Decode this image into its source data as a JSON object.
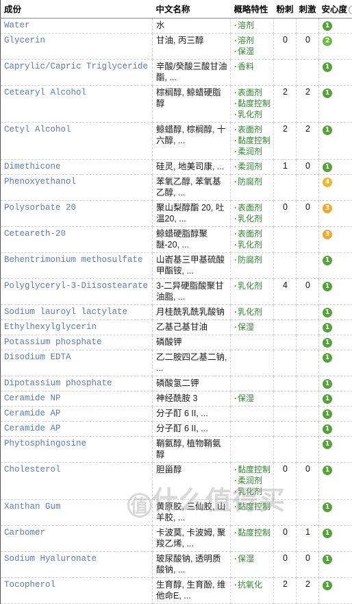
{
  "table": {
    "columns": [
      {
        "key": "name",
        "label": "成份"
      },
      {
        "key": "cn",
        "label": "中文名称"
      },
      {
        "key": "prop",
        "label": "概略特性"
      },
      {
        "key": "acne",
        "label": "粉刺"
      },
      {
        "key": "irr",
        "label": "刺激"
      },
      {
        "key": "safe",
        "label": "安心度"
      }
    ],
    "help_icon": "?",
    "rows": [
      {
        "name": "Water",
        "cn": "水",
        "props": [
          "溶剂"
        ],
        "acne": "",
        "irr": "",
        "safe": "1"
      },
      {
        "name": "Glycerin",
        "cn": "甘油, 丙三醇",
        "props": [
          "溶剂",
          "保湿"
        ],
        "acne": "0",
        "irr": "0",
        "safe": "2"
      },
      {
        "name": "Caprylic/Capric Triglyceride",
        "cn": "辛酸/癸酸三酸甘油酯, ...",
        "props": [
          "香料"
        ],
        "acne": "",
        "irr": "",
        "safe": "1"
      },
      {
        "name": "Cetearyl Alcohol",
        "cn": "棕榈醇, 鲸蜡硬脂醇",
        "props": [
          "表面剂",
          "黏度控制",
          "乳化剂"
        ],
        "acne": "2",
        "irr": "2",
        "safe": "1"
      },
      {
        "name": "Cetyl Alcohol",
        "cn": "鲸蜡醇, 棕榈醇, 十六醇, ...",
        "props": [
          "表面剂",
          "黏度控制",
          "柔润剂"
        ],
        "acne": "2",
        "irr": "2",
        "safe": "1"
      },
      {
        "name": "Dimethicone",
        "cn": "硅灵, 地美司康, ...",
        "props": [
          "柔润剂"
        ],
        "acne": "1",
        "irr": "0",
        "safe": "1"
      },
      {
        "name": "Phenoxyethanol",
        "cn": "苯氧乙醇, 苯氧基乙醇, ...",
        "props": [
          "防腐剂"
        ],
        "acne": "",
        "irr": "",
        "safe": "4"
      },
      {
        "name": "Polysorbate 20",
        "cn": "聚山梨醇酯 20, 吐温20, ...",
        "props": [
          "表面剂",
          "乳化剂"
        ],
        "acne": "0",
        "irr": "0",
        "safe": "3"
      },
      {
        "name": "Ceteareth-20",
        "cn": "鲸蜡硬脂醇聚醚-20, ...",
        "props": [
          "表面剂",
          "乳化剂"
        ],
        "acne": "",
        "irr": "",
        "safe": "3"
      },
      {
        "name": "Behentrimonium methosulfate",
        "cn": "山嵛基三甲基硫酸甲酯铵, ...",
        "props": [
          "防腐剂"
        ],
        "acne": "",
        "irr": "",
        "safe": "1"
      },
      {
        "name": "Polyglyceryl-3-Diisostearate",
        "cn": "3-二异硬脂酸聚甘油脂, ...",
        "props": [
          "乳化剂"
        ],
        "acne": "4",
        "irr": "0",
        "safe": "1"
      },
      {
        "name": "Sodium lauroyl lactylate",
        "cn": "月桂酰乳酰乳酸钠",
        "props": [
          "乳化剂"
        ],
        "acne": "",
        "irr": "",
        "safe": "1"
      },
      {
        "name": "Ethylhexylglycerin",
        "cn": "乙基己基甘油",
        "props": [
          "保湿"
        ],
        "acne": "",
        "irr": "",
        "safe": "1"
      },
      {
        "name": "Potassium phosphate",
        "cn": "磷酸钾",
        "props": [],
        "acne": "",
        "irr": "",
        "safe": "1"
      },
      {
        "name": "Disodium EDTA",
        "cn": "乙二胺四乙基二钠, ...",
        "props": [],
        "acne": "",
        "irr": "",
        "safe": "1"
      },
      {
        "name": "Dipotassium phosphate",
        "cn": "磷酸氢二钾",
        "props": [],
        "acne": "",
        "irr": "",
        "safe": "1"
      },
      {
        "name": "Ceramide NP",
        "cn": "神经酰胺 3",
        "props": [
          "保湿"
        ],
        "acne": "",
        "irr": "",
        "safe": "1"
      },
      {
        "name": "Ceramide AP",
        "cn": "分子酊 6 II, ...",
        "props": [],
        "acne": "",
        "irr": "",
        "safe": "1"
      },
      {
        "name": "Ceramide AP",
        "cn": "分子酊 6 II, ...",
        "props": [],
        "acne": "",
        "irr": "",
        "safe": "1"
      },
      {
        "name": "Phytosphingosine",
        "cn": "鞘氨醇, 植物鞘氨醇",
        "props": [],
        "acne": "",
        "irr": "",
        "safe": "1"
      },
      {
        "name": "Cholesterol",
        "cn": "胆甾醇",
        "props": [
          "黏度控制",
          "柔润剂",
          "乳化剂"
        ],
        "acne": "0",
        "irr": "0",
        "safe": "1"
      },
      {
        "name": "Xanthan Gum",
        "cn": "黄原胶, 三仙胶, 山羊胶, ...",
        "props": [
          "黏度控制"
        ],
        "acne": "",
        "irr": "",
        "safe": "1"
      },
      {
        "name": "Carbomer",
        "cn": "卡波莫, 卡波姆, 聚羧乙烯, ...",
        "props": [
          "黏度控制"
        ],
        "acne": "0",
        "irr": "1",
        "safe": "1"
      },
      {
        "name": "Sodium Hyaluronate",
        "cn": "玻尿酸钠, 透明质酸钠, ...",
        "props": [
          "保湿"
        ],
        "acne": "0",
        "irr": "0",
        "safe": "1"
      },
      {
        "name": "Tocopherol",
        "cn": "生育醇, 生育酚, 维他命E, ...",
        "props": [
          "抗氧化"
        ],
        "acne": "2",
        "irr": "2",
        "safe": "1"
      }
    ]
  },
  "watermark": {
    "circle_char": "值",
    "text": "什么值得买"
  }
}
